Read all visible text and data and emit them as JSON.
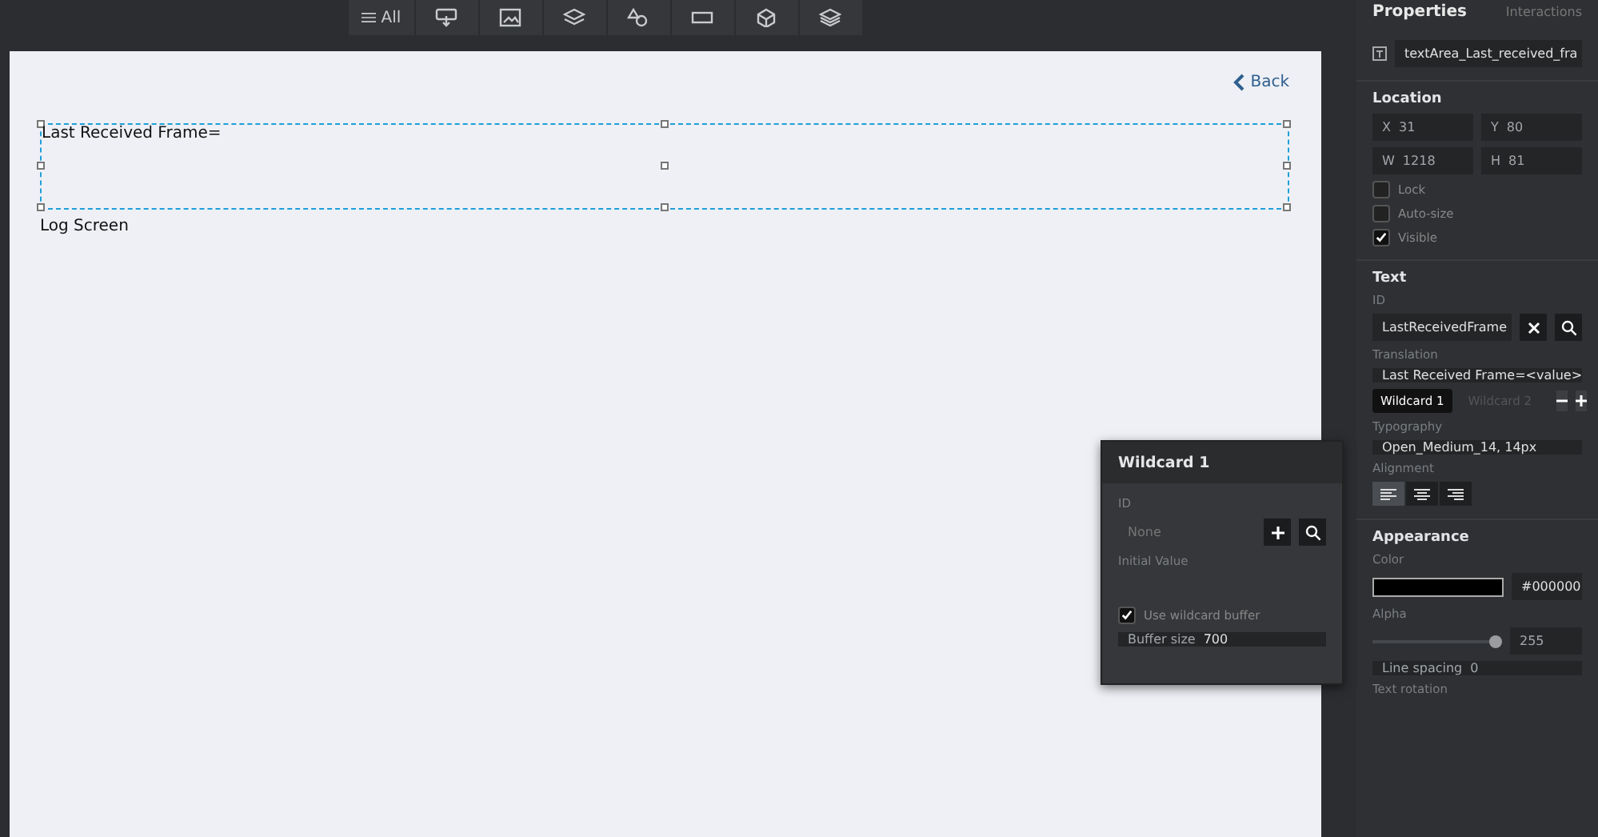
{
  "toolbar": {
    "items": [
      {
        "kind": "all",
        "label": "All"
      },
      {
        "kind": "touch"
      },
      {
        "kind": "image"
      },
      {
        "kind": "layers"
      },
      {
        "kind": "shapes"
      },
      {
        "kind": "field"
      },
      {
        "kind": "cube"
      },
      {
        "kind": "stack"
      }
    ]
  },
  "canvas": {
    "back_link": "Back",
    "text_area": {
      "text": "Last Received Frame="
    },
    "label": "Log Screen"
  },
  "wildcard_popup": {
    "title": "Wildcard 1",
    "id_label": "ID",
    "id_placeholder": "None",
    "initial_value_label": "Initial Value",
    "use_buffer": {
      "label": "Use wildcard buffer",
      "checked": true
    },
    "buffer_size": {
      "label": "Buffer size",
      "value": "700"
    }
  },
  "properties": {
    "tabs": [
      {
        "label": "Properties",
        "selected": true
      },
      {
        "label": "Interactions",
        "selected": false
      }
    ],
    "widget_name": "textArea_Last_received_fra",
    "location": {
      "title": "Location",
      "fields": [
        {
          "label": "X",
          "value": "31"
        },
        {
          "label": "Y",
          "value": "80"
        },
        {
          "label": "W",
          "value": "1218"
        },
        {
          "label": "H",
          "value": "81"
        }
      ],
      "checks": [
        {
          "label": "Lock",
          "checked": false
        },
        {
          "label": "Auto-size",
          "checked": false
        },
        {
          "label": "Visible",
          "checked": true
        }
      ]
    },
    "text": {
      "title": "Text",
      "id_label": "ID",
      "id_value": "LastReceivedFrame",
      "translation_label": "Translation",
      "translation_value": "Last Received Frame=<value>",
      "wildcards": [
        {
          "label": "Wildcard 1",
          "selected": true
        },
        {
          "label": "Wildcard 2",
          "selected": false
        }
      ],
      "typography_label": "Typography",
      "typography_value": "Open_Medium_14, 14px",
      "alignment_label": "Alignment",
      "alignments": [
        {
          "kind": "left",
          "selected": true
        },
        {
          "kind": "center",
          "selected": false
        },
        {
          "kind": "right",
          "selected": false
        }
      ]
    },
    "appearance": {
      "title": "Appearance",
      "color_label": "Color",
      "color": "#000000",
      "color_value": "#000000",
      "alpha_label": "Alpha",
      "alpha": {
        "level": 0.95
      },
      "alpha_value": "255",
      "line_spacing_label": "Line spacing",
      "line_spacing_value": "0",
      "text_rotation_label": "Text rotation"
    }
  }
}
